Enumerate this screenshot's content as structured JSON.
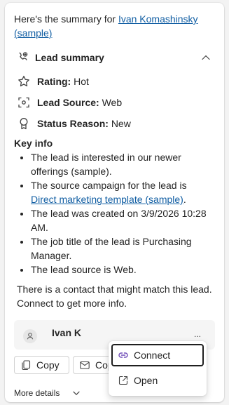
{
  "intro": {
    "prefix": "Here's the summary for ",
    "lead_name_link": "Ivan Komashinsky (sample)"
  },
  "lead_summary": {
    "title": "Lead summary",
    "fields": [
      {
        "label": "Rating:",
        "value": "Hot",
        "icon": "star-icon"
      },
      {
        "label": "Lead Source:",
        "value": "Web",
        "icon": "lead-source-icon"
      },
      {
        "label": "Status Reason:",
        "value": "New",
        "icon": "ribbon-icon"
      }
    ]
  },
  "key_info": {
    "title": "Key info",
    "items": [
      {
        "text": "The lead is interested in our newer offerings (sample)."
      },
      {
        "text_before": "The source campaign for the lead is ",
        "link": "Direct marketing template (sample)",
        "text_after": "."
      },
      {
        "text": "The lead was created on 3/9/2026 10:28 AM."
      },
      {
        "text": "The job title of the lead is Purchasing Manager."
      },
      {
        "text": "The lead source is Web."
      }
    ]
  },
  "contact_note": "There is a contact that might match this lead. Connect to get more info.",
  "contact": {
    "name": "Ivan K",
    "more_label": "..."
  },
  "buttons": {
    "copy1_label": "Copy",
    "copy2_label": "Copy"
  },
  "more_details_label": "More details",
  "menu": {
    "connect_label": "Connect",
    "open_label": "Open"
  },
  "colors": {
    "link": "#115ea3",
    "background": "#f3f3f3",
    "card": "#ffffff"
  }
}
